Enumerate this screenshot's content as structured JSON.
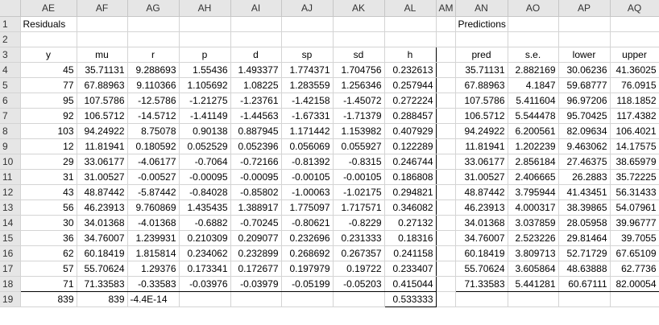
{
  "columns": [
    "AE",
    "AF",
    "AG",
    "AH",
    "AI",
    "AJ",
    "AK",
    "AL",
    "AM",
    "AN",
    "AO",
    "AP",
    "AQ"
  ],
  "row_numbers": [
    "1",
    "2",
    "3",
    "4",
    "5",
    "6",
    "7",
    "8",
    "9",
    "10",
    "11",
    "12",
    "13",
    "14",
    "15",
    "16",
    "17",
    "18",
    "19"
  ],
  "titles": {
    "residuals": "Residuals",
    "predictions": "Predictions"
  },
  "residual_headers": [
    "y",
    "mu",
    "r",
    "p",
    "d",
    "sp",
    "sd",
    "h"
  ],
  "prediction_headers": [
    "pred",
    "s.e.",
    "lower",
    "upper"
  ],
  "residual_rows": [
    [
      "45",
      "35.71131",
      "9.288693",
      "1.55436",
      "1.493377",
      "1.774371",
      "1.704756",
      "0.232613"
    ],
    [
      "77",
      "67.88963",
      "9.110366",
      "1.105692",
      "1.08225",
      "1.283559",
      "1.256346",
      "0.257944"
    ],
    [
      "95",
      "107.5786",
      "-12.5786",
      "-1.21275",
      "-1.23761",
      "-1.42158",
      "-1.45072",
      "0.272224"
    ],
    [
      "92",
      "106.5712",
      "-14.5712",
      "-1.41149",
      "-1.44563",
      "-1.67331",
      "-1.71379",
      "0.288457"
    ],
    [
      "103",
      "94.24922",
      "8.75078",
      "0.90138",
      "0.887945",
      "1.171442",
      "1.153982",
      "0.407929"
    ],
    [
      "12",
      "11.81941",
      "0.180592",
      "0.052529",
      "0.052396",
      "0.056069",
      "0.055927",
      "0.122289"
    ],
    [
      "29",
      "33.06177",
      "-4.06177",
      "-0.7064",
      "-0.72166",
      "-0.81392",
      "-0.8315",
      "0.246744"
    ],
    [
      "31",
      "31.00527",
      "-0.00527",
      "-0.00095",
      "-0.00095",
      "-0.00105",
      "-0.00105",
      "0.186808"
    ],
    [
      "43",
      "48.87442",
      "-5.87442",
      "-0.84028",
      "-0.85802",
      "-1.00063",
      "-1.02175",
      "0.294821"
    ],
    [
      "56",
      "46.23913",
      "9.760869",
      "1.435435",
      "1.388917",
      "1.775097",
      "1.717571",
      "0.346082"
    ],
    [
      "30",
      "34.01368",
      "-4.01368",
      "-0.6882",
      "-0.70245",
      "-0.80621",
      "-0.8229",
      "0.27132"
    ],
    [
      "36",
      "34.76007",
      "1.239931",
      "0.210309",
      "0.209077",
      "0.232696",
      "0.231333",
      "0.18316"
    ],
    [
      "62",
      "60.18419",
      "1.815814",
      "0.234062",
      "0.232899",
      "0.268692",
      "0.267357",
      "0.241158"
    ],
    [
      "57",
      "55.70624",
      "1.29376",
      "0.173341",
      "0.172677",
      "0.197979",
      "0.19722",
      "0.233407"
    ],
    [
      "71",
      "71.33583",
      "-0.33583",
      "-0.03976",
      "-0.03979",
      "-0.05199",
      "-0.05203",
      "0.415044"
    ]
  ],
  "prediction_rows": [
    [
      "35.71131",
      "2.882169",
      "30.06236",
      "41.36025"
    ],
    [
      "67.88963",
      "4.1847",
      "59.68777",
      "76.0915"
    ],
    [
      "107.5786",
      "5.411604",
      "96.97206",
      "118.1852"
    ],
    [
      "106.5712",
      "5.544478",
      "95.70425",
      "117.4382"
    ],
    [
      "94.24922",
      "6.200561",
      "82.09634",
      "106.4021"
    ],
    [
      "11.81941",
      "1.202239",
      "9.463062",
      "14.17575"
    ],
    [
      "33.06177",
      "2.856184",
      "27.46375",
      "38.65979"
    ],
    [
      "31.00527",
      "2.406665",
      "26.2883",
      "35.72225"
    ],
    [
      "48.87442",
      "3.795944",
      "41.43451",
      "56.31433"
    ],
    [
      "46.23913",
      "4.000317",
      "38.39865",
      "54.07961"
    ],
    [
      "34.01368",
      "3.037859",
      "28.05958",
      "39.96777"
    ],
    [
      "34.76007",
      "2.523226",
      "29.81464",
      "39.7055"
    ],
    [
      "60.18419",
      "3.809713",
      "52.71729",
      "67.65109"
    ],
    [
      "55.70624",
      "3.605864",
      "48.63888",
      "62.7736"
    ],
    [
      "71.33583",
      "5.441281",
      "60.67111",
      "82.00054"
    ]
  ],
  "totals": {
    "y": "839",
    "mu": "839",
    "r": "-4.4E-14",
    "h": "0.533333"
  }
}
